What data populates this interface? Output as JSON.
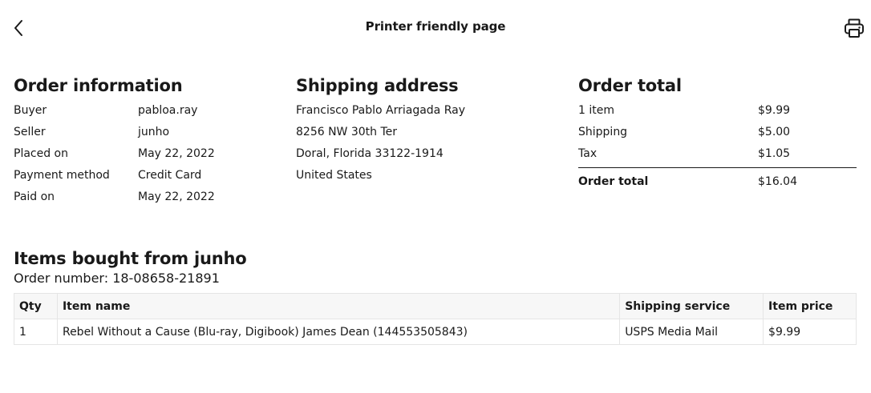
{
  "header": {
    "title": "Printer friendly page",
    "back_icon": "chevron-left-icon",
    "print_icon": "printer-icon"
  },
  "order_info": {
    "heading": "Order information",
    "rows": [
      {
        "label": "Buyer",
        "value": "pabloa.ray"
      },
      {
        "label": "Seller",
        "value": "junho"
      },
      {
        "label": "Placed on",
        "value": "May 22, 2022"
      },
      {
        "label": "Payment method",
        "value": "Credit Card"
      },
      {
        "label": "Paid on",
        "value": "May 22, 2022"
      }
    ]
  },
  "shipping_address": {
    "heading": "Shipping address",
    "lines": [
      "Francisco Pablo Arriagada Ray",
      "8256 NW 30th Ter",
      "Doral, Florida 33122-1914",
      "United States"
    ]
  },
  "order_total": {
    "heading": "Order total",
    "rows": [
      {
        "label": "1 item",
        "value": "$9.99"
      },
      {
        "label": "Shipping",
        "value": "$5.00"
      },
      {
        "label": "Tax",
        "value": "$1.05"
      }
    ],
    "total": {
      "label": "Order total",
      "value": "$16.04"
    }
  },
  "items": {
    "heading": "Items bought from junho",
    "order_number": "Order number: 18-08658-21891",
    "columns": [
      "Qty",
      "Item name",
      "Shipping service",
      "Item price"
    ],
    "rows": [
      {
        "qty": "1",
        "name": "Rebel Without a Cause (Blu-ray, Digibook) James Dean (144553505843)",
        "service": "USPS Media Mail",
        "price": "$9.99"
      }
    ]
  }
}
